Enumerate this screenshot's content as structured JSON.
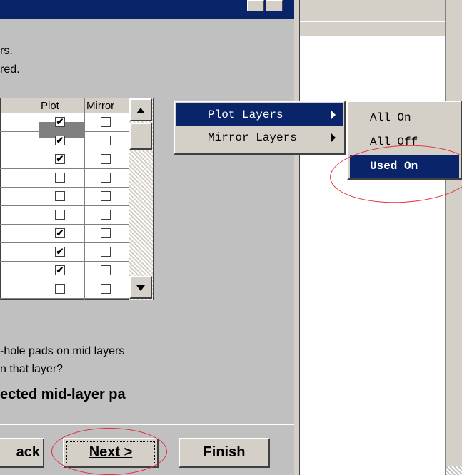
{
  "dialog": {
    "info_line1": "rs.",
    "info_line2": "red.",
    "table": {
      "columns": [
        "Plot",
        "Mirror"
      ],
      "rows": [
        {
          "plot": true,
          "mirror": false
        },
        {
          "plot": true,
          "mirror": false
        },
        {
          "plot": true,
          "mirror": false
        },
        {
          "plot": false,
          "mirror": false
        },
        {
          "plot": false,
          "mirror": false
        },
        {
          "plot": false,
          "mirror": false
        },
        {
          "plot": true,
          "mirror": false
        },
        {
          "plot": true,
          "mirror": false
        },
        {
          "plot": true,
          "mirror": false
        },
        {
          "plot": false,
          "mirror": false
        }
      ],
      "check_glyph": "✔"
    },
    "question_line1": "-hole pads on mid layers",
    "question_line2": "n that layer?",
    "option_text": "ected mid-layer pa",
    "buttons": {
      "back": "ack",
      "next": "Next >",
      "finish": "Finish"
    }
  },
  "context_menu": {
    "items": [
      "Plot Layers",
      "Mirror Layers"
    ]
  },
  "submenu": {
    "items": [
      "All On",
      "All Off",
      "Used On"
    ]
  },
  "icons": {
    "scroll_up": "up-arrow",
    "scroll_down": "down-arrow",
    "submenu_arrow": "right-triangle"
  },
  "colors": {
    "highlight": "#0a246a",
    "annotation": "#e0303c"
  }
}
